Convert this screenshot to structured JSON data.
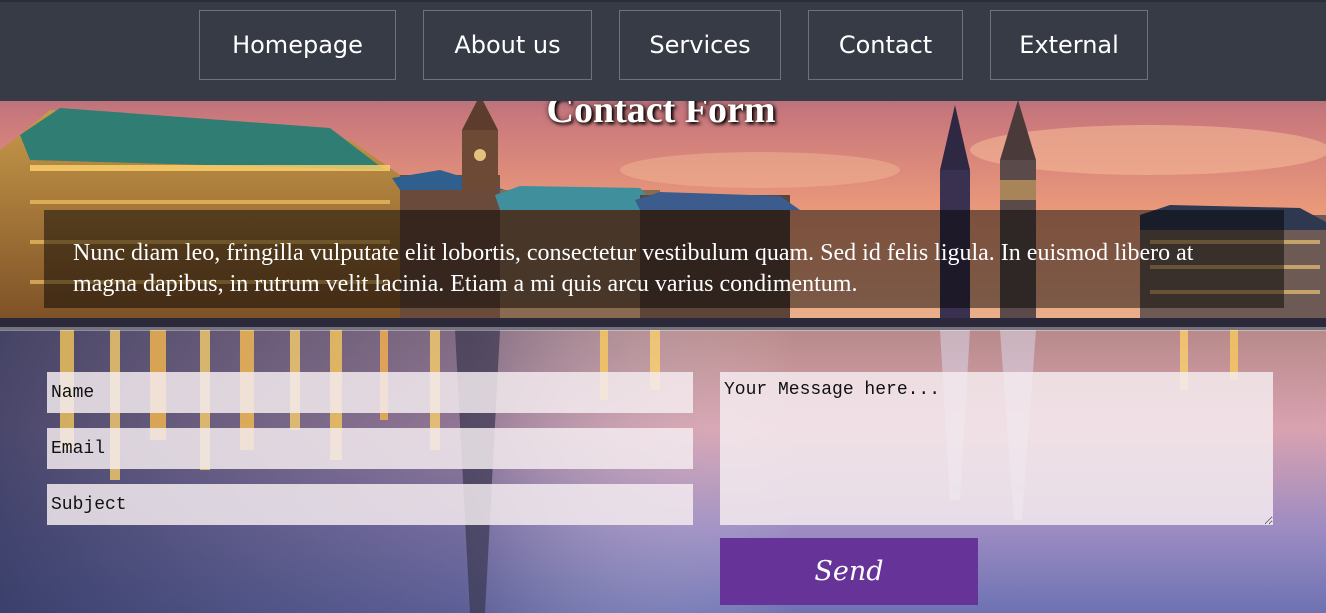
{
  "nav": {
    "items": [
      {
        "label": "Homepage"
      },
      {
        "label": "About us"
      },
      {
        "label": "Services"
      },
      {
        "label": "Contact"
      },
      {
        "label": "External"
      }
    ]
  },
  "page": {
    "title": "Contact Form",
    "intro": "Nunc diam leo, fringilla vulputate elit lobortis, consectetur vestibulum quam. Sed id felis ligula. In euismod libero at magna dapibus, in rutrum velit lacinia. Etiam a mi quis arcu varius condimentum."
  },
  "form": {
    "name_placeholder": "Name",
    "email_placeholder": "Email",
    "subject_placeholder": "Subject",
    "message_placeholder": "Your Message here...",
    "send_label": "Send"
  },
  "colors": {
    "navbar": "#363b46",
    "send_button": "#663399"
  }
}
